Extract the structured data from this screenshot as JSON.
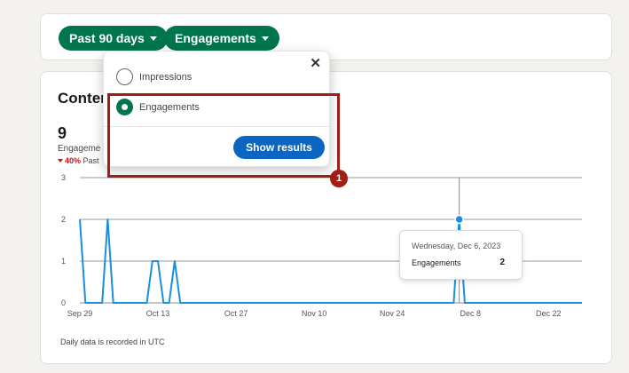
{
  "filters": {
    "range_label": "Past 90 days",
    "metric_label": "Engagements"
  },
  "content_card": {
    "heading": "Conter",
    "total_value": "9",
    "metric_name": "Engageme",
    "delta_percent": "40%",
    "delta_label": "Past",
    "footnote": "Daily data is recorded in UTC"
  },
  "dropdown": {
    "options": [
      {
        "label": "Impressions",
        "selected": false
      },
      {
        "label": "Engagements",
        "selected": true
      }
    ],
    "close_glyph": "✕",
    "submit_label": "Show results"
  },
  "tooltip": {
    "date": "Wednesday, Dec 6, 2023",
    "label": "Engagements",
    "value": "2"
  },
  "annotation": {
    "badge_number": "1",
    "color": "#a01e16"
  },
  "colors": {
    "pill_green": "#01754f",
    "button_blue": "#0a66c2",
    "line_blue": "#1a8fdd",
    "page_bg": "#f4f2ee"
  },
  "chart_data": {
    "type": "line",
    "ylim": [
      0,
      3
    ],
    "y_ticks": [
      "0",
      "1",
      "2",
      "3"
    ],
    "x_ticks": [
      {
        "label": "Sep 29",
        "day": 0
      },
      {
        "label": "Oct 13",
        "day": 14
      },
      {
        "label": "Oct 27",
        "day": 28
      },
      {
        "label": "Nov 10",
        "day": 42
      },
      {
        "label": "Nov 24",
        "day": 56
      },
      {
        "label": "Dec 8",
        "day": 70
      },
      {
        "label": "Dec 22",
        "day": 84
      }
    ],
    "x_range": [
      0,
      90
    ],
    "grid": true,
    "series": [
      {
        "values": [
          2,
          0,
          0,
          0,
          0,
          2,
          0,
          0,
          0,
          0,
          0,
          0,
          0,
          1,
          1,
          0,
          0,
          1,
          0,
          0,
          0,
          0,
          0,
          0,
          0,
          0,
          0,
          0,
          0,
          0,
          0,
          0,
          0,
          0,
          0,
          0,
          0,
          0,
          0,
          0,
          0,
          0,
          0,
          0,
          0,
          0,
          0,
          0,
          0,
          0,
          0,
          0,
          0,
          0,
          0,
          0,
          0,
          0,
          0,
          0,
          0,
          0,
          0,
          0,
          0,
          0,
          0,
          0,
          2,
          0,
          0,
          0,
          0,
          0,
          0,
          0,
          0,
          0,
          0,
          0,
          0,
          0,
          0,
          0,
          0,
          0,
          0,
          0,
          0,
          0,
          0
        ]
      }
    ],
    "highlight_day": 68,
    "highlight_value": 2
  }
}
